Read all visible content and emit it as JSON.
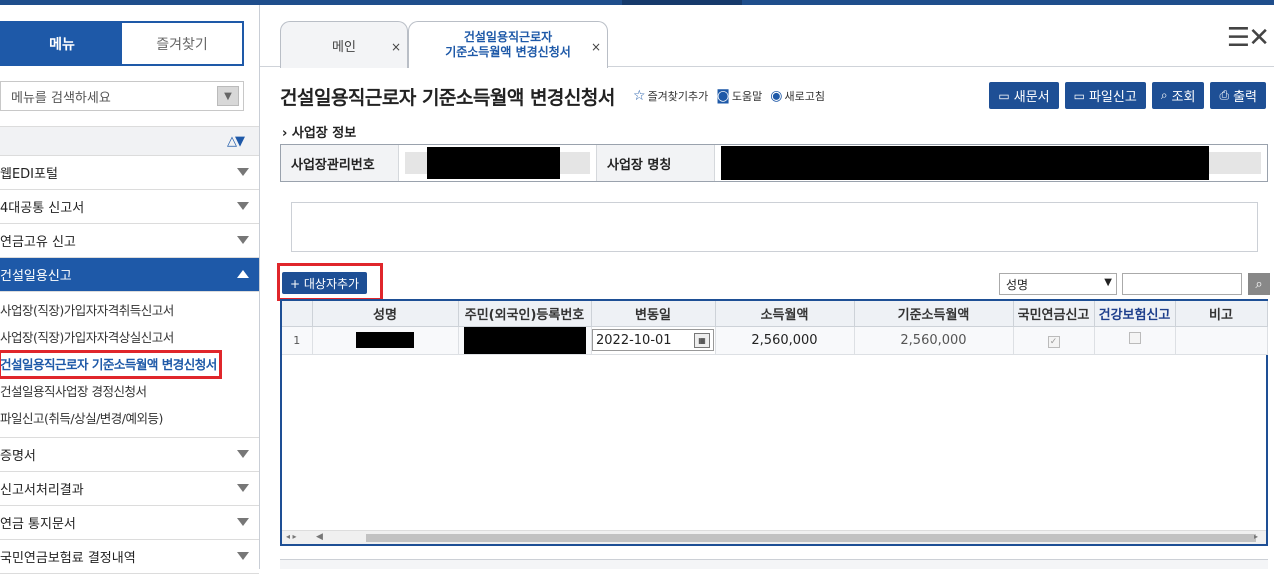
{
  "sidebar": {
    "tabs": [
      "메뉴",
      "즐겨찾기"
    ],
    "search_placeholder": "메뉴를 검색하세요",
    "items": [
      {
        "label": "웹EDI포털"
      },
      {
        "label": "4대공통 신고서"
      },
      {
        "label": "연금고유 신고"
      },
      {
        "label": "건설일용신고",
        "open": true
      }
    ],
    "subitems": [
      "사업장(직장)가입자자격취득신고서",
      "사업장(직장)가입자자격상실신고서",
      "건설일용직근로자 기준소득월액 변경신청서",
      "건설일용직사업장 경정신청서",
      "파일신고(취득/상실/변경/예외등)"
    ],
    "items_after": [
      {
        "label": "증명서"
      },
      {
        "label": "신고서처리결과"
      },
      {
        "label": "연금 통지문서"
      },
      {
        "label": "국민연금보험료 결정내역"
      }
    ]
  },
  "tabs": {
    "main_label": "메인",
    "active_label_line1": "건설일용직근로자",
    "active_label_line2": "기준소득월액 변경신청서",
    "close": "×"
  },
  "page": {
    "title": "건설일용직근로자 기준소득월액 변경신청서",
    "fav_link": "즐겨찾기추가",
    "help_link": "도움말",
    "refresh_link": "새로고침",
    "buttons": {
      "new_doc": "새문서",
      "file_report": "파일신고",
      "search": "조회",
      "print": "출력"
    },
    "section_label": "사업장 정보",
    "info": {
      "mgmt_no_label": "사업장관리번호",
      "name_label": "사업장 명칭"
    },
    "add_button": "+ 대상자추가",
    "filter_selected": "성명"
  },
  "grid": {
    "columns": [
      "",
      "성명",
      "주민(외국인)등록번호",
      "변동일",
      "소득월액",
      "기준소득월액",
      "국민연금신고",
      "건강보험신고",
      "비고"
    ],
    "rows": [
      {
        "no": "1",
        "date": "2022-10-01",
        "income": "2,560,000",
        "base_income": "2,560,000"
      }
    ]
  },
  "colors": {
    "accent": "#1e59a8",
    "button": "#1e4f95",
    "highlight": "#e0262b"
  }
}
